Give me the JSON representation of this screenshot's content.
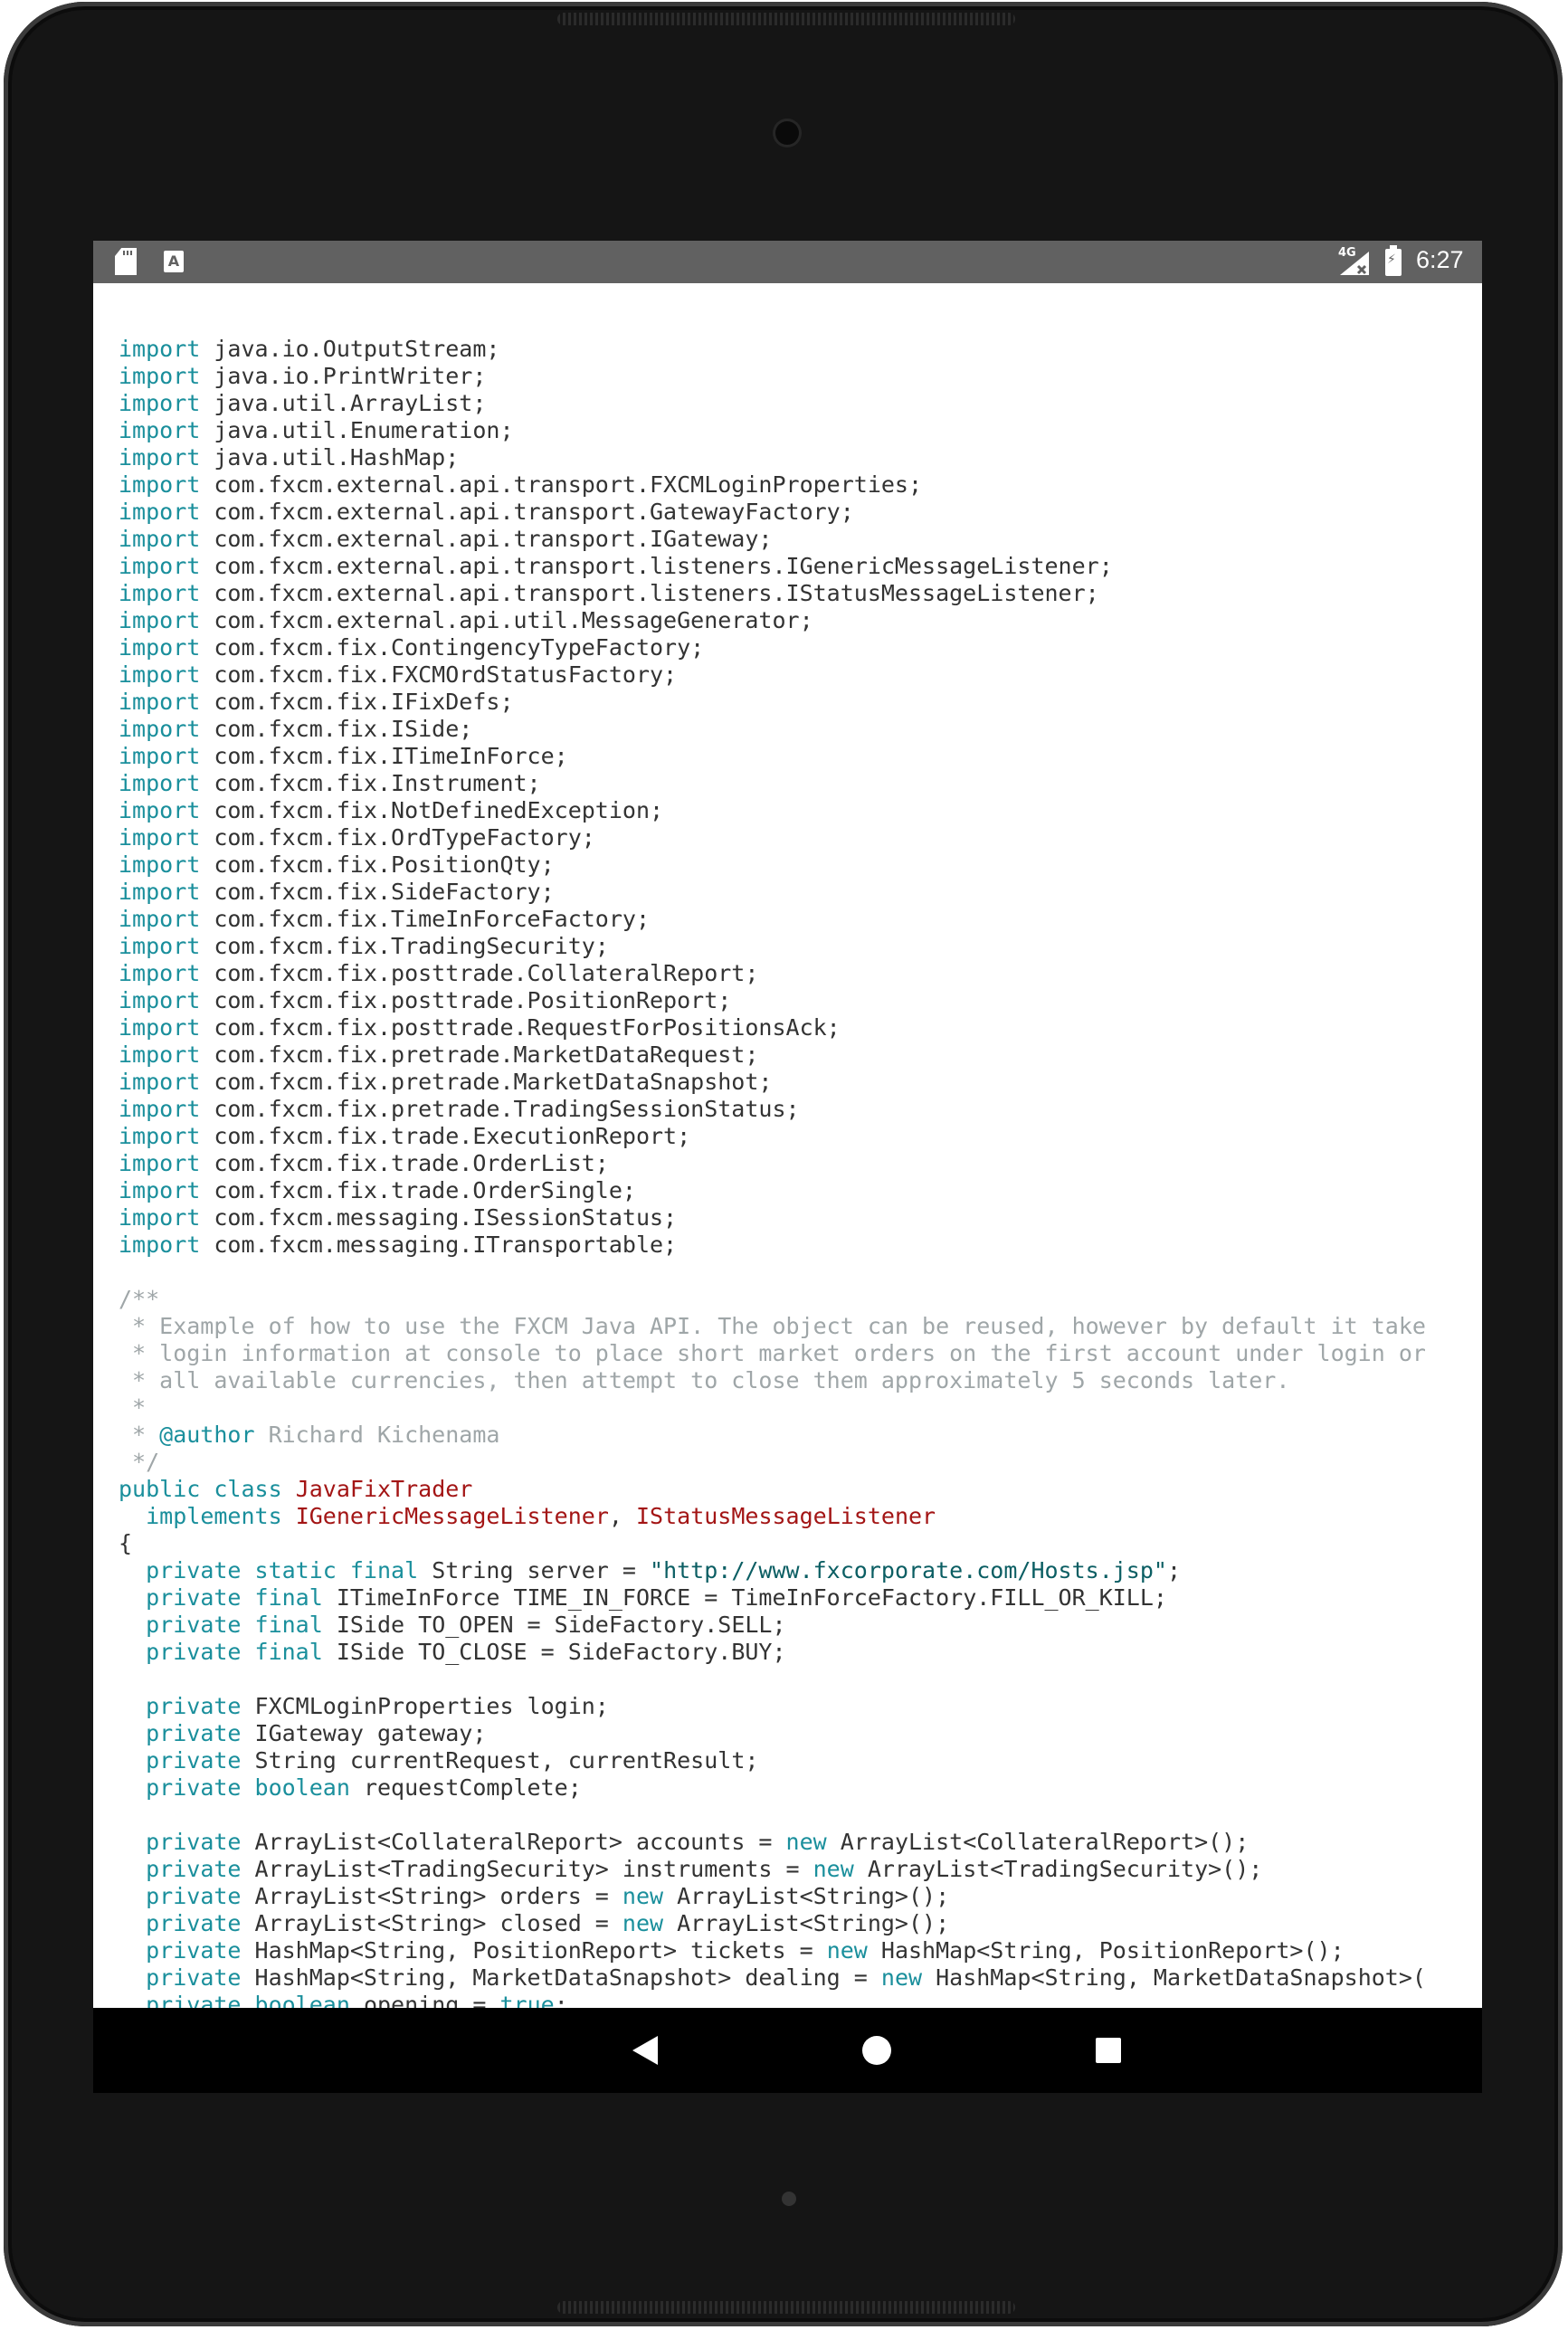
{
  "status_bar": {
    "network": "4G",
    "time": "6:27",
    "icons": [
      "sd-card-icon",
      "font-a-icon",
      "signal-no-data-icon",
      "battery-charging-icon"
    ]
  },
  "nav_bar": {
    "icons": [
      "back-icon",
      "home-icon",
      "recents-icon"
    ]
  },
  "colors": {
    "keyword": "#1a8f9c",
    "class_name": "#a31515",
    "string": "#0b5e63",
    "comment": "#9fa6a8",
    "plain": "#333333",
    "status_bar": "#616161"
  },
  "code_lines": [
    [
      [
        "kw",
        "import"
      ],
      [
        "tx",
        " java.io.OutputStream;"
      ]
    ],
    [
      [
        "kw",
        "import"
      ],
      [
        "tx",
        " java.io.PrintWriter;"
      ]
    ],
    [
      [
        "kw",
        "import"
      ],
      [
        "tx",
        " java.util.ArrayList;"
      ]
    ],
    [
      [
        "kw",
        "import"
      ],
      [
        "tx",
        " java.util.Enumeration;"
      ]
    ],
    [
      [
        "kw",
        "import"
      ],
      [
        "tx",
        " java.util.HashMap;"
      ]
    ],
    [
      [
        "kw",
        "import"
      ],
      [
        "tx",
        " com.fxcm.external.api.transport.FXCMLoginProperties;"
      ]
    ],
    [
      [
        "kw",
        "import"
      ],
      [
        "tx",
        " com.fxcm.external.api.transport.GatewayFactory;"
      ]
    ],
    [
      [
        "kw",
        "import"
      ],
      [
        "tx",
        " com.fxcm.external.api.transport.IGateway;"
      ]
    ],
    [
      [
        "kw",
        "import"
      ],
      [
        "tx",
        " com.fxcm.external.api.transport.listeners.IGenericMessageListener;"
      ]
    ],
    [
      [
        "kw",
        "import"
      ],
      [
        "tx",
        " com.fxcm.external.api.transport.listeners.IStatusMessageListener;"
      ]
    ],
    [
      [
        "kw",
        "import"
      ],
      [
        "tx",
        " com.fxcm.external.api.util.MessageGenerator;"
      ]
    ],
    [
      [
        "kw",
        "import"
      ],
      [
        "tx",
        " com.fxcm.fix.ContingencyTypeFactory;"
      ]
    ],
    [
      [
        "kw",
        "import"
      ],
      [
        "tx",
        " com.fxcm.fix.FXCMOrdStatusFactory;"
      ]
    ],
    [
      [
        "kw",
        "import"
      ],
      [
        "tx",
        " com.fxcm.fix.IFixDefs;"
      ]
    ],
    [
      [
        "kw",
        "import"
      ],
      [
        "tx",
        " com.fxcm.fix.ISide;"
      ]
    ],
    [
      [
        "kw",
        "import"
      ],
      [
        "tx",
        " com.fxcm.fix.ITimeInForce;"
      ]
    ],
    [
      [
        "kw",
        "import"
      ],
      [
        "tx",
        " com.fxcm.fix.Instrument;"
      ]
    ],
    [
      [
        "kw",
        "import"
      ],
      [
        "tx",
        " com.fxcm.fix.NotDefinedException;"
      ]
    ],
    [
      [
        "kw",
        "import"
      ],
      [
        "tx",
        " com.fxcm.fix.OrdTypeFactory;"
      ]
    ],
    [
      [
        "kw",
        "import"
      ],
      [
        "tx",
        " com.fxcm.fix.PositionQty;"
      ]
    ],
    [
      [
        "kw",
        "import"
      ],
      [
        "tx",
        " com.fxcm.fix.SideFactory;"
      ]
    ],
    [
      [
        "kw",
        "import"
      ],
      [
        "tx",
        " com.fxcm.fix.TimeInForceFactory;"
      ]
    ],
    [
      [
        "kw",
        "import"
      ],
      [
        "tx",
        " com.fxcm.fix.TradingSecurity;"
      ]
    ],
    [
      [
        "kw",
        "import"
      ],
      [
        "tx",
        " com.fxcm.fix.posttrade.CollateralReport;"
      ]
    ],
    [
      [
        "kw",
        "import"
      ],
      [
        "tx",
        " com.fxcm.fix.posttrade.PositionReport;"
      ]
    ],
    [
      [
        "kw",
        "import"
      ],
      [
        "tx",
        " com.fxcm.fix.posttrade.RequestForPositionsAck;"
      ]
    ],
    [
      [
        "kw",
        "import"
      ],
      [
        "tx",
        " com.fxcm.fix.pretrade.MarketDataRequest;"
      ]
    ],
    [
      [
        "kw",
        "import"
      ],
      [
        "tx",
        " com.fxcm.fix.pretrade.MarketDataSnapshot;"
      ]
    ],
    [
      [
        "kw",
        "import"
      ],
      [
        "tx",
        " com.fxcm.fix.pretrade.TradingSessionStatus;"
      ]
    ],
    [
      [
        "kw",
        "import"
      ],
      [
        "tx",
        " com.fxcm.fix.trade.ExecutionReport;"
      ]
    ],
    [
      [
        "kw",
        "import"
      ],
      [
        "tx",
        " com.fxcm.fix.trade.OrderList;"
      ]
    ],
    [
      [
        "kw",
        "import"
      ],
      [
        "tx",
        " com.fxcm.fix.trade.OrderSingle;"
      ]
    ],
    [
      [
        "kw",
        "import"
      ],
      [
        "tx",
        " com.fxcm.messaging.ISessionStatus;"
      ]
    ],
    [
      [
        "kw",
        "import"
      ],
      [
        "tx",
        " com.fxcm.messaging.ITransportable;"
      ]
    ],
    [],
    [
      [
        "cm",
        "/**"
      ]
    ],
    [
      [
        "cm",
        " * Example of how to use the FXCM Java API. The object can be reused, however by default it take"
      ]
    ],
    [
      [
        "cm",
        " * login information at console to place short market orders on the first account under login or"
      ]
    ],
    [
      [
        "cm",
        " * all available currencies, then attempt to close them approximately 5 seconds later."
      ]
    ],
    [
      [
        "cm",
        " *"
      ]
    ],
    [
      [
        "cm",
        " * "
      ],
      [
        "ann",
        "@author"
      ],
      [
        "cm",
        " Richard Kichenama"
      ]
    ],
    [
      [
        "cm",
        " */"
      ]
    ],
    [
      [
        "kw",
        "public class"
      ],
      [
        "tx",
        " "
      ],
      [
        "cls",
        "JavaFixTrader"
      ]
    ],
    [
      [
        "tx",
        "  "
      ],
      [
        "kw",
        "implements"
      ],
      [
        "tx",
        " "
      ],
      [
        "cls",
        "IGenericMessageListener"
      ],
      [
        "tx",
        ", "
      ],
      [
        "cls",
        "IStatusMessageListener"
      ]
    ],
    [
      [
        "tx",
        "{"
      ]
    ],
    [
      [
        "tx",
        "  "
      ],
      [
        "kw",
        "private static final"
      ],
      [
        "tx",
        " String server = "
      ],
      [
        "str",
        "\"http://www.fxcorporate.com/Hosts.jsp\""
      ],
      [
        "tx",
        ";"
      ]
    ],
    [
      [
        "tx",
        "  "
      ],
      [
        "kw",
        "private final"
      ],
      [
        "tx",
        " ITimeInForce TIME_IN_FORCE = TimeInForceFactory.FILL_OR_KILL;"
      ]
    ],
    [
      [
        "tx",
        "  "
      ],
      [
        "kw",
        "private final"
      ],
      [
        "tx",
        " ISide TO_OPEN = SideFactory.SELL;"
      ]
    ],
    [
      [
        "tx",
        "  "
      ],
      [
        "kw",
        "private final"
      ],
      [
        "tx",
        " ISide TO_CLOSE = SideFactory.BUY;"
      ]
    ],
    [],
    [
      [
        "tx",
        "  "
      ],
      [
        "kw",
        "private"
      ],
      [
        "tx",
        " FXCMLoginProperties login;"
      ]
    ],
    [
      [
        "tx",
        "  "
      ],
      [
        "kw",
        "private"
      ],
      [
        "tx",
        " IGateway gateway;"
      ]
    ],
    [
      [
        "tx",
        "  "
      ],
      [
        "kw",
        "private"
      ],
      [
        "tx",
        " String currentRequest, currentResult;"
      ]
    ],
    [
      [
        "tx",
        "  "
      ],
      [
        "kw",
        "private boolean"
      ],
      [
        "tx",
        " requestComplete;"
      ]
    ],
    [],
    [
      [
        "tx",
        "  "
      ],
      [
        "kw",
        "private"
      ],
      [
        "tx",
        " ArrayList<CollateralReport> accounts = "
      ],
      [
        "kw",
        "new"
      ],
      [
        "tx",
        " ArrayList<CollateralReport>();"
      ]
    ],
    [
      [
        "tx",
        "  "
      ],
      [
        "kw",
        "private"
      ],
      [
        "tx",
        " ArrayList<TradingSecurity> instruments = "
      ],
      [
        "kw",
        "new"
      ],
      [
        "tx",
        " ArrayList<TradingSecurity>();"
      ]
    ],
    [
      [
        "tx",
        "  "
      ],
      [
        "kw",
        "private"
      ],
      [
        "tx",
        " ArrayList<String> orders = "
      ],
      [
        "kw",
        "new"
      ],
      [
        "tx",
        " ArrayList<String>();"
      ]
    ],
    [
      [
        "tx",
        "  "
      ],
      [
        "kw",
        "private"
      ],
      [
        "tx",
        " ArrayList<String> closed = "
      ],
      [
        "kw",
        "new"
      ],
      [
        "tx",
        " ArrayList<String>();"
      ]
    ],
    [
      [
        "tx",
        "  "
      ],
      [
        "kw",
        "private"
      ],
      [
        "tx",
        " HashMap<String, PositionReport> tickets = "
      ],
      [
        "kw",
        "new"
      ],
      [
        "tx",
        " HashMap<String, PositionReport>();"
      ]
    ],
    [
      [
        "tx",
        "  "
      ],
      [
        "kw",
        "private"
      ],
      [
        "tx",
        " HashMap<String, MarketDataSnapshot> dealing = "
      ],
      [
        "kw",
        "new"
      ],
      [
        "tx",
        " HashMap<String, MarketDataSnapshot>("
      ]
    ],
    [
      [
        "tx",
        "  "
      ],
      [
        "kw",
        "private boolean"
      ],
      [
        "tx",
        " opening = "
      ],
      [
        "kw",
        "true"
      ],
      [
        "tx",
        ";"
      ]
    ]
  ]
}
